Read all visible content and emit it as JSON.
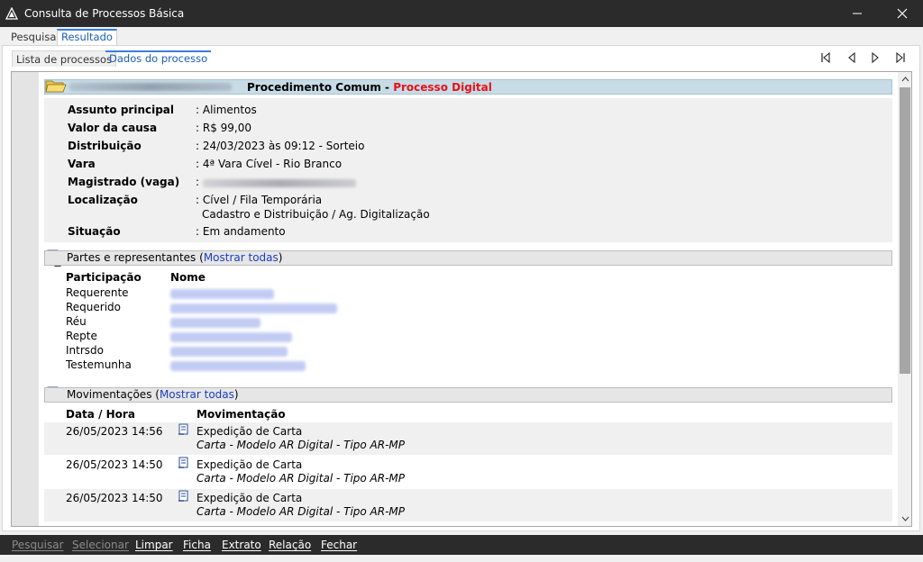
{
  "window": {
    "title": "Consulta de Processos Básica",
    "colors": {
      "titlebar": "#2b2b2b",
      "accent": "#1a5fb4",
      "link": "#1a3ec2",
      "digital": "#e8121a"
    }
  },
  "tabs": [
    {
      "label": "Pesquisa",
      "active": false
    },
    {
      "label": "Resultado",
      "active": true
    }
  ],
  "subtabs": [
    {
      "label": "Lista de processos",
      "active": false
    },
    {
      "label": "Dados do processo",
      "active": true
    }
  ],
  "nav_icons": [
    "first-page-icon",
    "previous-icon",
    "next-icon",
    "last-page-icon"
  ],
  "process": {
    "class": "Procedimento Comum",
    "separator": " - ",
    "digital": "Processo Digital",
    "fields": [
      {
        "label": "Assunto principal",
        "value": ": Alimentos"
      },
      {
        "label": "Valor da causa",
        "value": ": R$ 99,00"
      },
      {
        "label": "Distribuição",
        "value": ": 24/03/2023 às 09:12 - Sorteio"
      },
      {
        "label": "Vara",
        "value": ": 4ª Vara Cível - Rio Branco"
      },
      {
        "label": "Magistrado (vaga)",
        "value": ":"
      },
      {
        "label": "Localização",
        "value": ": Cível / Fila Temporária"
      },
      {
        "label": "",
        "value": "Cadastro e Distribuição / Ag. Digitalização"
      },
      {
        "label": "Situação",
        "value": ": Em andamento"
      }
    ]
  },
  "partes": {
    "title": "Partes e representantes (",
    "link": "Mostrar todas",
    "close": ")",
    "col_participacao": "Participação",
    "col_nome": "Nome",
    "rows": [
      {
        "role": "Requerente"
      },
      {
        "role": "Requerido"
      },
      {
        "role": "Réu"
      },
      {
        "role": "Repte"
      },
      {
        "role": "Intrsdo"
      },
      {
        "role": "Testemunha"
      }
    ]
  },
  "movimentacoes": {
    "title": "Movimentações (",
    "link": "Mostrar todas",
    "close": ")",
    "col_data": "Data / Hora",
    "col_mov": "Movimentação",
    "rows": [
      {
        "date": "26/05/2023 14:56",
        "title": "Expedição de Carta",
        "detail": "Carta - Modelo AR Digital - Tipo AR-MP"
      },
      {
        "date": "26/05/2023 14:50",
        "title": "Expedição de Carta",
        "detail": "Carta - Modelo AR Digital - Tipo AR-MP"
      },
      {
        "date": "26/05/2023 14:50",
        "title": "Expedição de Carta",
        "detail": "Carta - Modelo AR Digital - Tipo AR-MP"
      }
    ]
  },
  "bottom_buttons": [
    {
      "label": "Pesquisar",
      "enabled": false
    },
    {
      "label": "Selecionar",
      "enabled": false
    },
    {
      "label": "Limpar",
      "enabled": true
    },
    {
      "label": "Ficha",
      "enabled": true
    },
    {
      "label": "Extrato",
      "enabled": true
    },
    {
      "label": "Relação",
      "enabled": true
    },
    {
      "label": "Fechar",
      "enabled": true
    }
  ]
}
